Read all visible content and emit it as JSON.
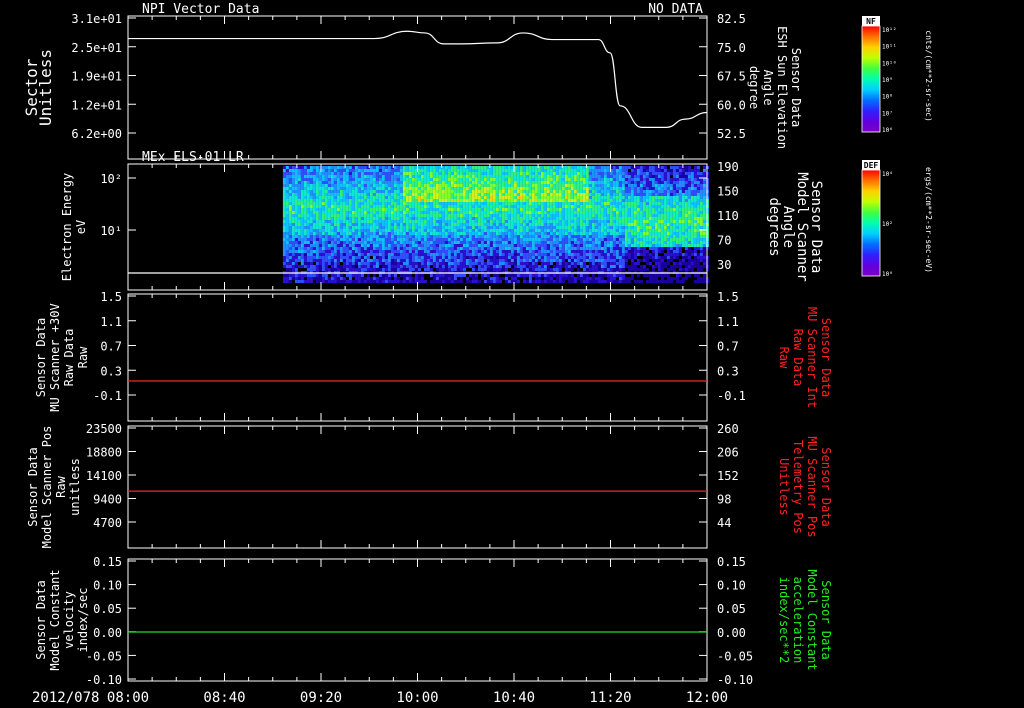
{
  "colors": {
    "background": "#000000",
    "axis": "#ffffff",
    "trace_white": "#ffffff",
    "trace_red": "#ff2020",
    "trace_green": "#22dd22",
    "label_red": "#ff2020",
    "label_green": "#22ee22"
  },
  "time_axis": {
    "date_label": "2012/078",
    "tick_labels": [
      "08:00",
      "08:40",
      "09:20",
      "10:00",
      "10:40",
      "11:20",
      "12:00"
    ],
    "tick_hours": [
      8.0,
      8.6667,
      9.3333,
      10.0,
      10.6667,
      11.3333,
      12.0
    ],
    "range_hours": [
      8.0,
      12.0
    ]
  },
  "colorbars": [
    {
      "label": "NF",
      "units": "cnts/(cm**2-sr-sec)",
      "tick_labels": [
        "10¹²",
        "10¹¹",
        "10¹⁰",
        "10⁹",
        "10⁸",
        "10⁷",
        "10⁶"
      ]
    },
    {
      "label": "DEF",
      "units": "ergs/(cm**2-sr-sec-eV)",
      "tick_labels": [
        "10⁴",
        "10²",
        "10⁰"
      ]
    }
  ],
  "chart_data": [
    {
      "type": "line",
      "title": "NPI Vector Data",
      "status": "NO DATA",
      "ylabel": [
        "Sector",
        "Unitless"
      ],
      "left_ticks": [
        "3.1e+01",
        "2.5e+01",
        "1.9e+01",
        "1.2e+01",
        "6.2e+00"
      ],
      "right_ticks": [
        "82.5",
        "75.0",
        "67.5",
        "60.0",
        "52.5"
      ],
      "right_ylabel": [
        "Sensor Data",
        "ESH Sun Elevation",
        "Angle",
        "degree"
      ],
      "right_ylim": [
        46.9,
        82.5
      ],
      "series": [
        {
          "color": "white",
          "x": [
            8.0,
            9.7,
            9.93,
            10.05,
            10.18,
            10.3,
            10.55,
            10.73,
            10.93,
            11.25,
            11.33,
            11.4,
            11.55,
            11.72,
            11.85,
            12.0
          ],
          "y": [
            76.3,
            76.3,
            78.5,
            78.0,
            74.7,
            74.7,
            75.0,
            78.0,
            76.0,
            76.0,
            72.0,
            56.0,
            49.5,
            49.5,
            52.0,
            54.0
          ]
        }
      ]
    },
    {
      "type": "heatmap",
      "title": "MEx ELS-01 LR",
      "ylabel": [
        "Electron Energy",
        "eV"
      ],
      "left_ticks": [
        "10²",
        "10¹"
      ],
      "right_ticks": [
        "190",
        "150",
        "110",
        "70",
        "30"
      ],
      "right_ylabel": [
        "Sensor Data",
        "Model Scanner",
        "Angle",
        "degrees"
      ],
      "right_ylim": [
        10,
        190
      ],
      "log_y": true,
      "data_start_hour": 9.07,
      "series": [
        {
          "color": "white",
          "x": [
            8.0,
            12.0
          ],
          "y": [
            13,
            13
          ]
        }
      ]
    },
    {
      "type": "line",
      "ylabel": [
        "Sensor Data",
        "MU Scanner +30V",
        "Raw Data",
        "Raw"
      ],
      "left_ticks": [
        "1.5",
        "1.1",
        "0.7",
        "0.3",
        "-0.1"
      ],
      "right_ticks": [
        "1.5",
        "1.1",
        "0.7",
        "0.3",
        "-0.1"
      ],
      "right_ylabel": [
        "Sensor Data",
        "MU Scanner Int",
        "Raw Data",
        "Raw"
      ],
      "ylim": [
        -0.3,
        1.5
      ],
      "series": [
        {
          "color": "red",
          "x": [
            8.0,
            12.0
          ],
          "y": [
            0.0,
            0.0
          ]
        }
      ]
    },
    {
      "type": "line",
      "ylabel": [
        "Sensor Data",
        "Model Scanner Pos",
        "Raw",
        "unitless"
      ],
      "left_ticks": [
        "23500",
        "18800",
        "14100",
        "9400",
        "4700"
      ],
      "right_ticks": [
        "260",
        "206",
        "152",
        "98",
        "44"
      ],
      "right_ylabel": [
        "Sensor Data",
        "MU Scanner Pos",
        "Telemetry Pos",
        "Unitless"
      ],
      "ylim": [
        0,
        23500
      ],
      "series": [
        {
          "color": "red",
          "x": [
            8.0,
            12.0
          ],
          "y": [
            8200,
            8200
          ]
        }
      ]
    },
    {
      "type": "line",
      "ylabel": [
        "Sensor Data",
        "Model Constant",
        "velocity",
        "index/sec"
      ],
      "left_ticks": [
        "0.15",
        "0.10",
        "0.05",
        "0.00",
        "-0.05",
        "-0.10"
      ],
      "right_ticks": [
        "0.15",
        "0.10",
        "0.05",
        "0.00",
        "-0.05",
        "-0.10"
      ],
      "right_ylabel": [
        "Sensor Data",
        "Model Constant",
        "acceleration",
        "index/sec**2"
      ],
      "ylim": [
        -0.1,
        0.15
      ],
      "series": [
        {
          "color": "green",
          "x": [
            8.0,
            12.0
          ],
          "y": [
            0.0,
            0.0
          ]
        }
      ]
    }
  ]
}
